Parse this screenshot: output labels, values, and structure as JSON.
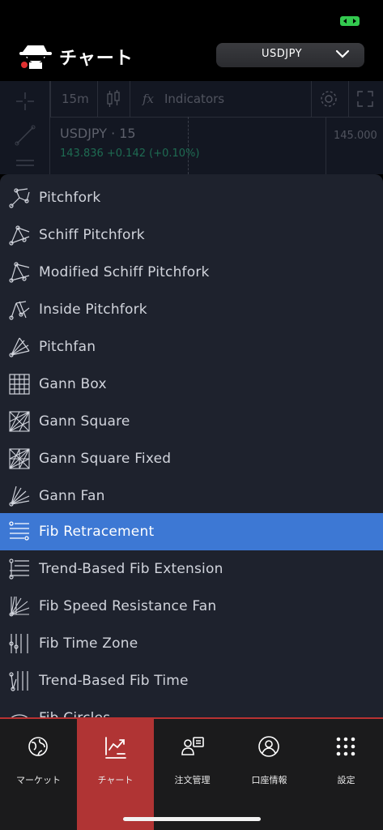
{
  "header": {
    "title": "チャート",
    "symbol": "USDJPY"
  },
  "chart": {
    "interval": "15m",
    "indicators_label": "Indicators",
    "symbol_interval": "USDJPY · 15",
    "price_line": "143.836 +0.142 (+0.10%)",
    "axis_value": "145.000"
  },
  "menu": {
    "items": [
      {
        "label": "Pitchfork",
        "icon": "pitchfork-icon"
      },
      {
        "label": "Schiff Pitchfork",
        "icon": "schiff-pitchfork-icon"
      },
      {
        "label": "Modified Schiff Pitchfork",
        "icon": "modified-schiff-pitchfork-icon"
      },
      {
        "label": "Inside Pitchfork",
        "icon": "inside-pitchfork-icon"
      },
      {
        "label": "Pitchfan",
        "icon": "pitchfan-icon"
      },
      {
        "label": "Gann Box",
        "icon": "gann-box-icon"
      },
      {
        "label": "Gann Square",
        "icon": "gann-square-icon"
      },
      {
        "label": "Gann Square Fixed",
        "icon": "gann-square-fixed-icon"
      },
      {
        "label": "Gann Fan",
        "icon": "gann-fan-icon"
      },
      {
        "label": "Fib Retracement",
        "icon": "fib-retracement-icon",
        "selected": true
      },
      {
        "label": "Trend-Based Fib Extension",
        "icon": "trend-fib-extension-icon"
      },
      {
        "label": "Fib Speed Resistance Fan",
        "icon": "fib-speed-resistance-fan-icon"
      },
      {
        "label": "Fib Time Zone",
        "icon": "fib-time-zone-icon"
      },
      {
        "label": "Trend-Based Fib Time",
        "icon": "trend-fib-time-icon"
      },
      {
        "label": "Fib Circles",
        "icon": "fib-circles-icon"
      }
    ]
  },
  "nav": {
    "items": [
      {
        "label": "マーケット",
        "icon": "market-globe-icon"
      },
      {
        "label": "チャート",
        "icon": "chart-trend-icon",
        "active": true
      },
      {
        "label": "注文管理",
        "icon": "order-management-icon"
      },
      {
        "label": "口座情報",
        "icon": "account-user-icon"
      },
      {
        "label": "設定",
        "icon": "settings-grid-icon"
      }
    ]
  },
  "colors": {
    "selected": "#3d78d4",
    "active_tab": "#b03434",
    "menu_bg": "#1e222d"
  }
}
